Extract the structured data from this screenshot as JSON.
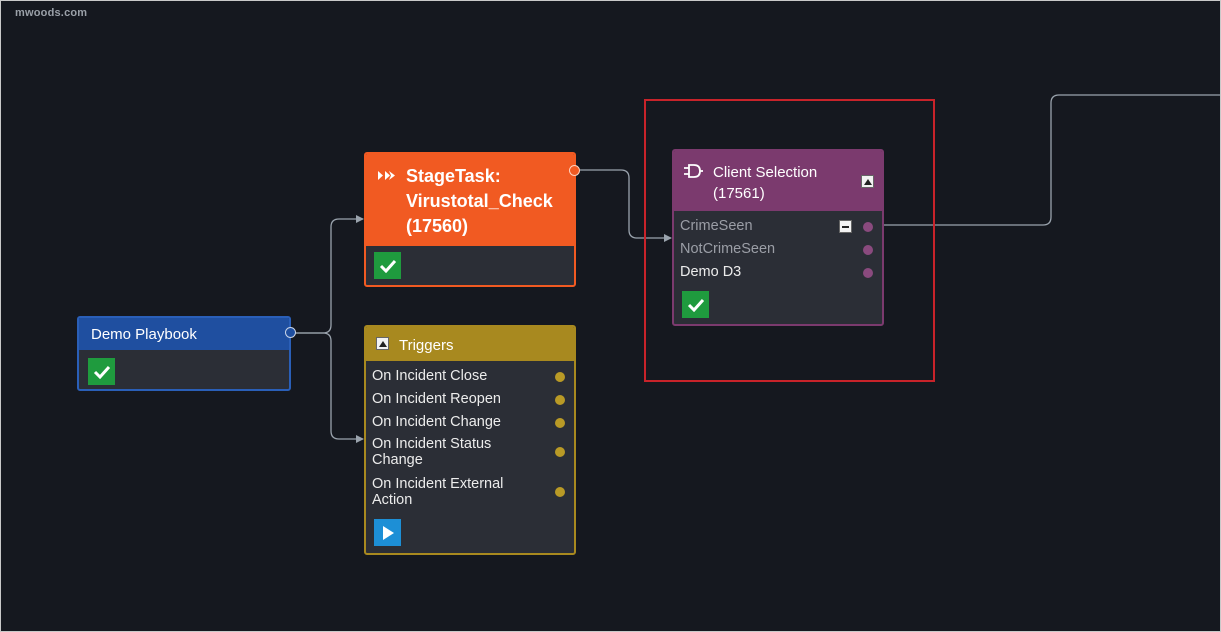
{
  "watermark": "mwoods.com",
  "colors": {
    "canvas_bg": "#15181f",
    "playbook_blue": "#1f4fa0",
    "stage_orange": "#f15a22",
    "trigger_gold": "#a8891f",
    "selection_purple": "#7b3a6e",
    "check_green": "#1f9b3e",
    "play_blue": "#1d8fd6",
    "highlight_red": "#c8232a"
  },
  "nodes": {
    "playbook": {
      "title": "Demo Playbook",
      "status_icon": "check-icon"
    },
    "stage_task": {
      "icon": "chevron-double-right-icon",
      "title_line1": "StageTask:",
      "title_line2": "Virustotal_Check",
      "title_line3": "(17560)",
      "status_icon": "check-icon"
    },
    "triggers": {
      "title": "Triggers",
      "collapse_icon": "caret-up-icon",
      "items": [
        {
          "label_line1": "On Incident Close",
          "label_line2": ""
        },
        {
          "label_line1": "On Incident Reopen",
          "label_line2": ""
        },
        {
          "label_line1": "On Incident Change",
          "label_line2": ""
        },
        {
          "label_line1": "On Incident Status",
          "label_line2": "Change"
        },
        {
          "label_line1": "On Incident External",
          "label_line2": "Action"
        }
      ],
      "run_icon": "play-icon"
    },
    "client_selection": {
      "icon": "plug-icon",
      "title_line1": "Client Selection",
      "title_line2": "(17561)",
      "collapse_icon": "caret-up-icon",
      "outputs": [
        {
          "label": "CrimeSeen",
          "state": "disabled",
          "has_minus": true
        },
        {
          "label": "NotCrimeSeen",
          "state": "disabled",
          "has_minus": false
        },
        {
          "label": "Demo D3",
          "state": "active",
          "has_minus": false
        }
      ],
      "status_icon": "check-icon"
    }
  }
}
